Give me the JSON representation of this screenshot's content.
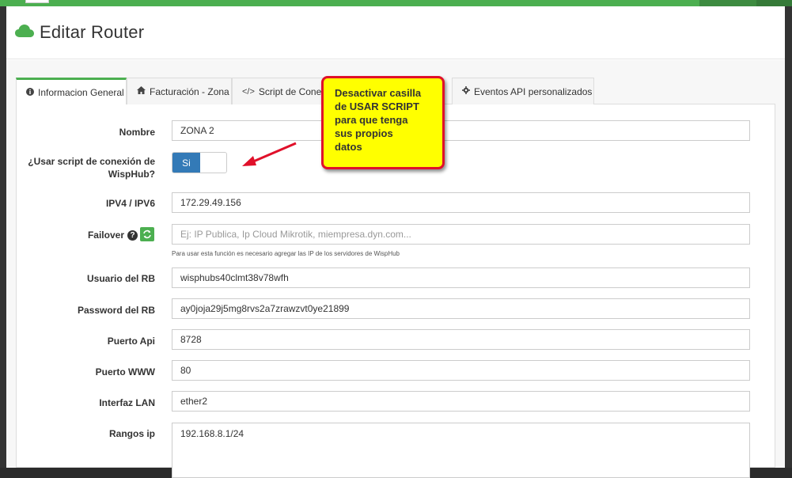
{
  "header": {
    "title": "Editar Router",
    "icon": "cloud-icon"
  },
  "tabs": [
    {
      "label": "Informacion General",
      "icon": "info-icon"
    },
    {
      "label": "Facturación - Zona",
      "icon": "home-icon"
    },
    {
      "label": "Script de Conexió",
      "icon": "code-icon"
    },
    {
      "label": "Eventos API personalizados",
      "icon": "gear-icon"
    }
  ],
  "form": {
    "nombre": {
      "label": "Nombre",
      "value": "ZONA 2"
    },
    "usar_script": {
      "label_line1": "¿Usar script de conexión de",
      "label_line2": "WispHub?",
      "toggle_value": "Si"
    },
    "ip": {
      "label": "IPV4 / IPV6",
      "value": "172.29.49.156"
    },
    "failover": {
      "label": "Failover",
      "help_glyph": "?",
      "placeholder": "Ej: IP Publica, Ip Cloud Mikrotik, miempresa.dyn.com...",
      "help_text": "Para usar esta función es necesario agregar las IP de los servidores de WispHub"
    },
    "usuario": {
      "label": "Usuario del RB",
      "value": "wisphubs40clmt38v78wfh"
    },
    "password": {
      "label": "Password del RB",
      "value": "ay0joja29j5mg8rvs2a7zrawzvt0ye21899"
    },
    "puerto_api": {
      "label": "Puerto Api",
      "value": "8728"
    },
    "puerto_www": {
      "label": "Puerto WWW",
      "value": "80"
    },
    "interfaz": {
      "label": "Interfaz LAN",
      "value": "ether2"
    },
    "rangos": {
      "label": "Rangos ip",
      "value": "192.168.8.1/24"
    }
  },
  "callout": {
    "lines": [
      "Desactivar casilla",
      "de USAR SCRIPT",
      "para que tenga",
      "sus propios",
      "datos"
    ]
  },
  "colors": {
    "accent": "#4caf50",
    "toggle": "#337ab7",
    "callout_bg": "#ffff00",
    "callout_border": "#e0102a"
  }
}
